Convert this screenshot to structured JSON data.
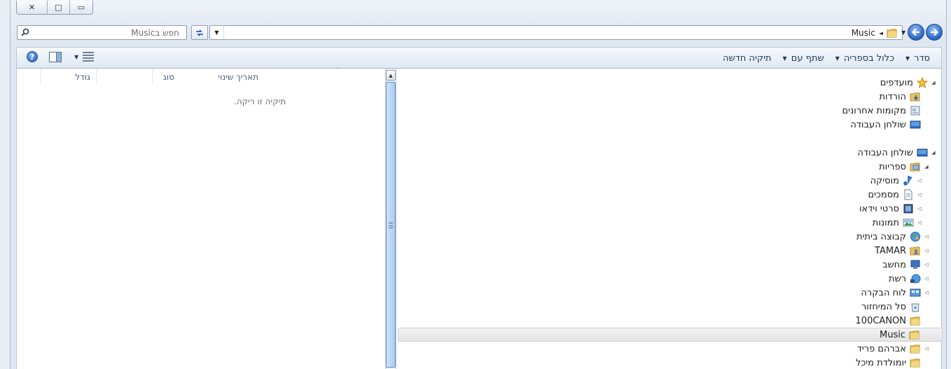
{
  "window": {
    "title": "",
    "caption_buttons": {
      "close": "✕",
      "maximize": "□",
      "minimize": "▭"
    }
  },
  "address_bar": {
    "crumbs": [
      "Music"
    ],
    "separator": "◄"
  },
  "search": {
    "placeholder": "חפש בMusic"
  },
  "toolbar": {
    "items": [
      {
        "label": "סדר",
        "has_dropdown": true
      },
      {
        "label": "כלול בספריה",
        "has_dropdown": true
      },
      {
        "label": "שתף עם",
        "has_dropdown": true
      },
      {
        "label": "תיקיה חדשה",
        "has_dropdown": false
      }
    ],
    "help_label": "?"
  },
  "file_list": {
    "columns": [
      "תאריך שינוי",
      "סוג",
      "גודל"
    ],
    "empty_message": "תיקיה זו ריקה."
  },
  "nav_tree": [
    {
      "label": "מועדפים",
      "icon": "star-icon",
      "level": 0,
      "expander": "expanded"
    },
    {
      "label": "הורדות",
      "icon": "downloads-folder-icon",
      "level": 1,
      "expander": "none"
    },
    {
      "label": "מקומות אחרונים",
      "icon": "recent-places-icon",
      "level": 1,
      "expander": "none"
    },
    {
      "label": "שולחן העבודה",
      "icon": "desktop-icon",
      "level": 1,
      "expander": "none"
    },
    {
      "label": "שולחן העבודה",
      "icon": "desktop-icon",
      "level": 0,
      "expander": "expanded"
    },
    {
      "label": "ספריות",
      "icon": "libraries-icon",
      "level": 1,
      "expander": "expanded"
    },
    {
      "label": "מוסיקה",
      "icon": "music-icon",
      "level": 2,
      "expander": "collapsed"
    },
    {
      "label": "מסמכים",
      "icon": "documents-icon",
      "level": 2,
      "expander": "collapsed"
    },
    {
      "label": "סרטי וידאו",
      "icon": "videos-icon",
      "level": 2,
      "expander": "collapsed"
    },
    {
      "label": "תמונות",
      "icon": "pictures-icon",
      "level": 2,
      "expander": "collapsed"
    },
    {
      "label": "קבוצה ביתית",
      "icon": "homegroup-icon",
      "level": 1,
      "expander": "collapsed"
    },
    {
      "label": "TAMAR",
      "icon": "user-folder-icon",
      "level": 1,
      "expander": "collapsed"
    },
    {
      "label": "מחשב",
      "icon": "computer-icon",
      "level": 1,
      "expander": "collapsed"
    },
    {
      "label": "רשת",
      "icon": "network-icon",
      "level": 1,
      "expander": "collapsed"
    },
    {
      "label": "לוח הבקרה",
      "icon": "control-panel-icon",
      "level": 1,
      "expander": "collapsed"
    },
    {
      "label": "סל המיחזור",
      "icon": "recycle-bin-icon",
      "level": 1,
      "expander": "none"
    },
    {
      "label": "100CANON",
      "icon": "folder-icon",
      "level": 1,
      "expander": "none"
    },
    {
      "label": "Music",
      "icon": "folder-icon",
      "level": 1,
      "expander": "none",
      "selected": true
    },
    {
      "label": "אברהם פריד",
      "icon": "folder-icon",
      "level": 1,
      "expander": "collapsed"
    },
    {
      "label": "יומולדת מיכל",
      "icon": "folder-icon",
      "level": 1,
      "expander": "none"
    }
  ]
}
